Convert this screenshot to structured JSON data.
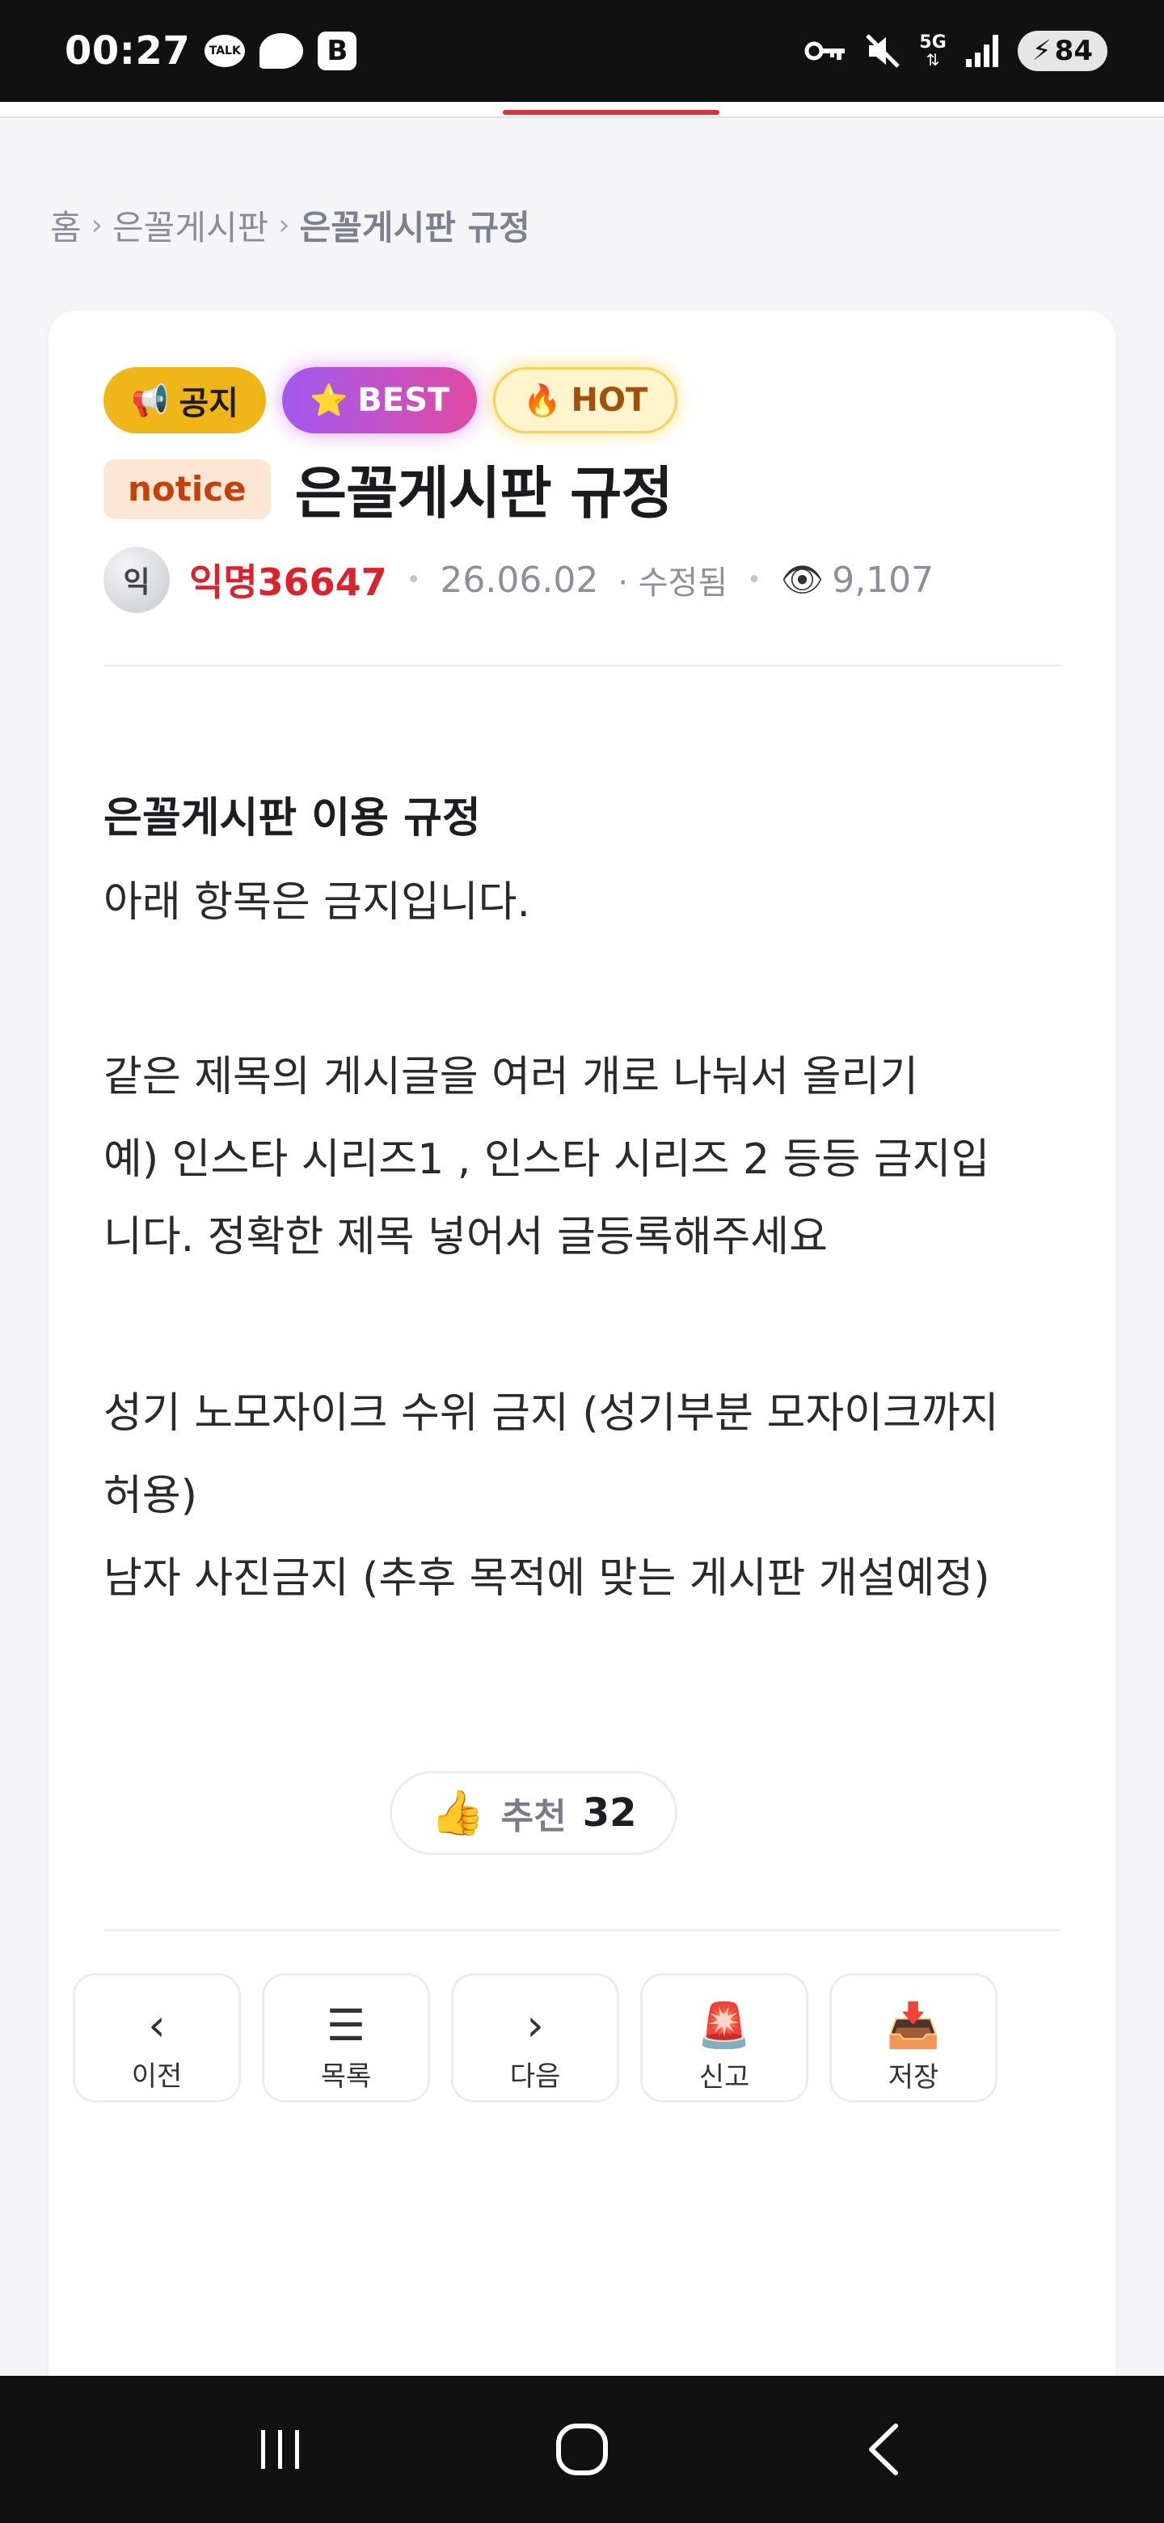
{
  "status_bar": {
    "time": "00:27",
    "talk_label": "TALK",
    "b_label": "B",
    "network_label": "5G",
    "battery": "84"
  },
  "breadcrumb": {
    "home": "홈",
    "board": "은꼴게시판",
    "current": "은꼴게시판 규정",
    "separator": "›"
  },
  "post": {
    "badges": [
      {
        "icon": "📢",
        "label": "공지"
      },
      {
        "icon": "⭐",
        "label": "BEST"
      },
      {
        "icon": "🔥",
        "label": "HOT"
      }
    ],
    "tag": "notice",
    "title": "은꼴게시판 규정",
    "avatar_initial": "익",
    "author": "익명36647",
    "date": "26.06.02",
    "edited": "· 수정됨",
    "views": "9,107",
    "body": {
      "heading": "은꼴게시판 이용 규정",
      "line1": "아래 항목은 금지입니다.",
      "line2": "같은 제목의 게시글을 여러 개로 나눠서 올리기",
      "line3a": "예) 인스타 시리즈1 , 인스타 시리즈 2 등등 금지입",
      "line3b": "니다. 정확한 제목 넣어서 글등록해주세요",
      "line4a": "성기 노모자이크 수위 금지 (성기부분 모자이크까지",
      "line4b": "허용)",
      "line5": "남자 사진금지 (추후 목적에 맞는 게시판 개설예정)"
    },
    "recommend": {
      "label": "추천",
      "count": "32"
    }
  },
  "actions": [
    {
      "icon": "‹",
      "label": "이전"
    },
    {
      "icon": "☰",
      "label": "목록"
    },
    {
      "icon": "›",
      "label": "다음"
    },
    {
      "icon": "🚨",
      "label": "신고"
    },
    {
      "icon": "📥",
      "label": "저장"
    }
  ],
  "colors": {
    "accent_red": "#d9242d",
    "notice_yellow": "#f0b517",
    "best_gradient_start": "#a259f0",
    "best_gradient_end": "#e04ba2",
    "hot_bg": "#fff4cc"
  }
}
